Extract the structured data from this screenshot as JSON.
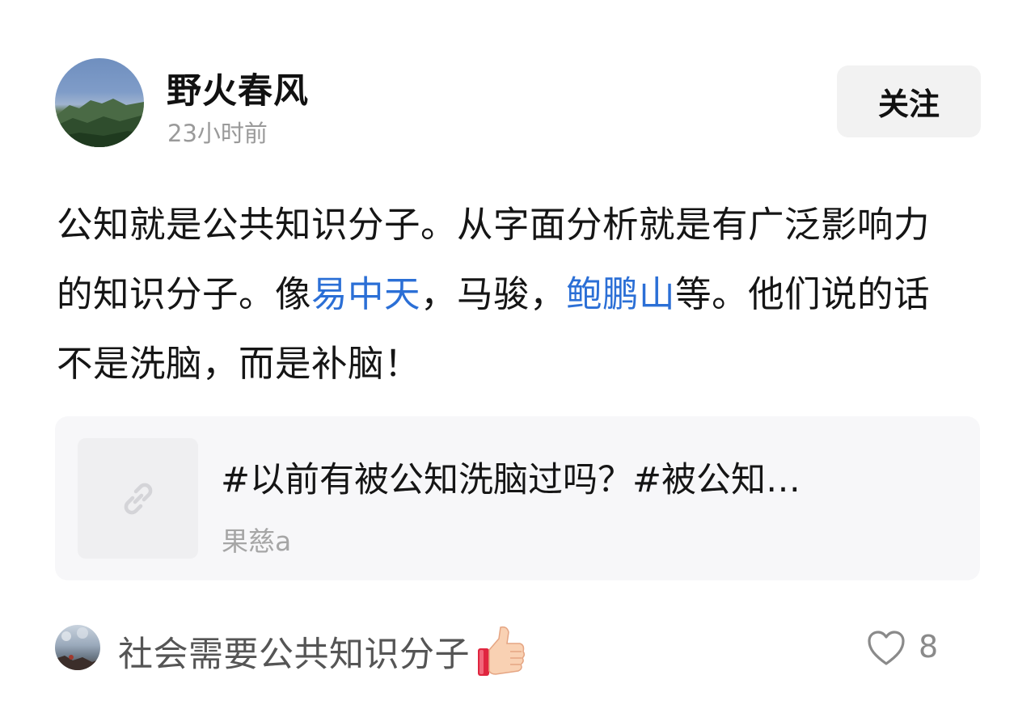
{
  "post": {
    "author": "野火春风",
    "time": "23小时前",
    "follow_label": "关注",
    "text": [
      {
        "t": "公知就是公共知识分子。从字面分析就是有广泛影响力的知识分子。像",
        "link": false
      },
      {
        "t": "易中天",
        "link": true
      },
      {
        "t": "，马骏，",
        "link": false
      },
      {
        "t": "鲍鹏山",
        "link": true
      },
      {
        "t": "等。他们说的话不是洗脑，而是补脑！",
        "link": false
      }
    ]
  },
  "link_card": {
    "title": "#以前有被公知洗脑过吗？#被公知…",
    "source": "果慈a",
    "thumb_icon": "link-icon"
  },
  "comment": {
    "text": "社会需要公共知识分子",
    "emoji_icon": "thumbs-up-icon",
    "like_icon": "heart-outline-icon",
    "like_count": "8"
  },
  "colors": {
    "mention": "#2b6fd6",
    "muted": "#9a9a9a",
    "card_bg": "#f7f7f9"
  }
}
